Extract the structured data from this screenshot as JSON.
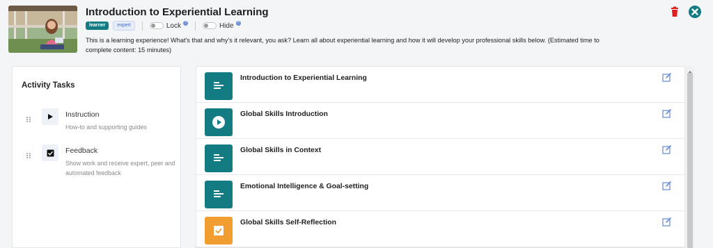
{
  "header": {
    "title": "Introduction to Experiential Learning",
    "badges": [
      "learner",
      "expert"
    ],
    "lock_label": "Lock",
    "hide_label": "Hide",
    "description": "This is a learning experience! What's that and why's it relevant, you ask? Learn all about experiential learning and how it will develop your professional skills below. (Estimated time to complete content: 15 minutes)",
    "thumbnail_icon": "person-outdoors-photo",
    "delete_icon": "trash-icon",
    "close_icon": "close-circle-icon"
  },
  "activity_tasks": {
    "title": "Activity Tasks",
    "items": [
      {
        "name": "Instruction",
        "description": "How-to and supporting guides",
        "icon": "play-icon"
      },
      {
        "name": "Feedback",
        "description": "Show work and receive expert, peer and automated feedback",
        "icon": "checkbox-icon"
      }
    ]
  },
  "content_list": {
    "items": [
      {
        "title": "Introduction to Experiential Learning",
        "icon": "text-lines-icon",
        "color": "#137c83"
      },
      {
        "title": "Global Skills Introduction",
        "icon": "play-circle-icon",
        "color": "#137c83"
      },
      {
        "title": "Global Skills in Context",
        "icon": "text-lines-icon",
        "color": "#137c83"
      },
      {
        "title": "Emotional Intelligence & Goal-setting",
        "icon": "text-lines-icon",
        "color": "#137c83"
      },
      {
        "title": "Global Skills Self-Reflection",
        "icon": "checkbox-icon",
        "color": "#f29d30"
      }
    ]
  },
  "colors": {
    "accent": "#137c83",
    "orange": "#f29d30",
    "delete": "#e02020"
  }
}
